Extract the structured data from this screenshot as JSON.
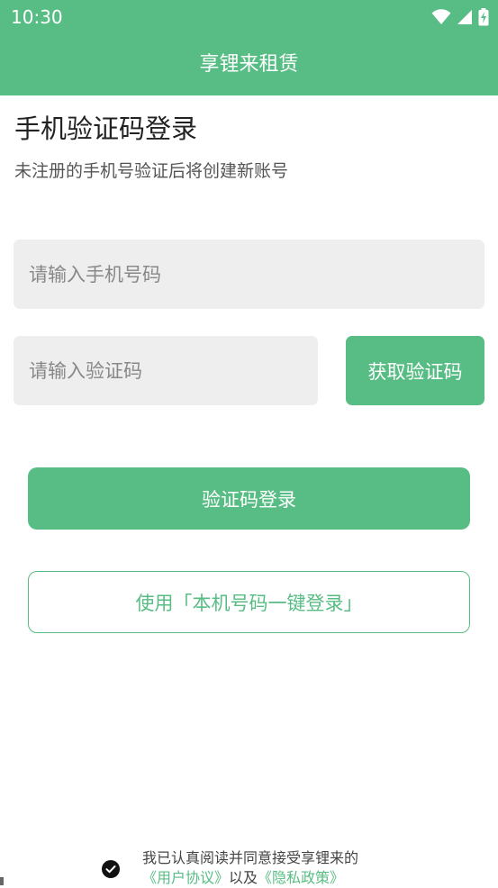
{
  "status_bar": {
    "time": "10:30",
    "icons": [
      "wifi-icon",
      "signal-icon",
      "battery-charging-icon"
    ]
  },
  "app_bar": {
    "title": "享锂来租赁"
  },
  "main": {
    "heading": "手机验证码登录",
    "subheading": "未注册的手机号验证后将创建新账号",
    "phone_input": {
      "value": "",
      "placeholder": "请输入手机号码"
    },
    "code_input": {
      "value": "",
      "placeholder": "请输入验证码"
    },
    "get_code_label": "获取验证码",
    "login_label": "验证码登录",
    "one_key_label": "使用「本机号码一键登录」"
  },
  "agreement": {
    "checked": true,
    "prefix": "我已认真阅读并同意接受享锂来的",
    "user_agreement": "《用户协议》",
    "joiner": "以及",
    "privacy_policy": "《隐私政策》"
  },
  "colors": {
    "accent": "#58BD84",
    "input_bg": "#EEEEEE",
    "text_dark": "#222222",
    "text_muted": "#555555"
  }
}
